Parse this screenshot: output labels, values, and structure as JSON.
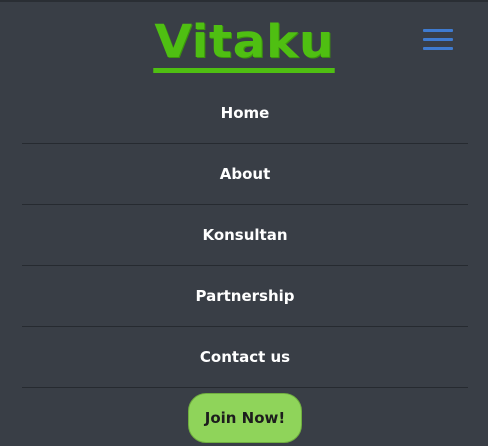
{
  "brand": {
    "name": "Vitaku",
    "color": "#4fbf12"
  },
  "menu_toggle": {
    "icon": "hamburger-menu-icon",
    "color": "#3f7bd0"
  },
  "nav": {
    "items": [
      {
        "label": "Home"
      },
      {
        "label": "About"
      },
      {
        "label": "Konsultan"
      },
      {
        "label": "Partnership"
      },
      {
        "label": "Contact us"
      }
    ]
  },
  "cta": {
    "label": "Join Now!",
    "color": "#8fd45a"
  },
  "theme": {
    "background": "#393e46",
    "divider": "#262a30",
    "text": "#ffffff"
  }
}
